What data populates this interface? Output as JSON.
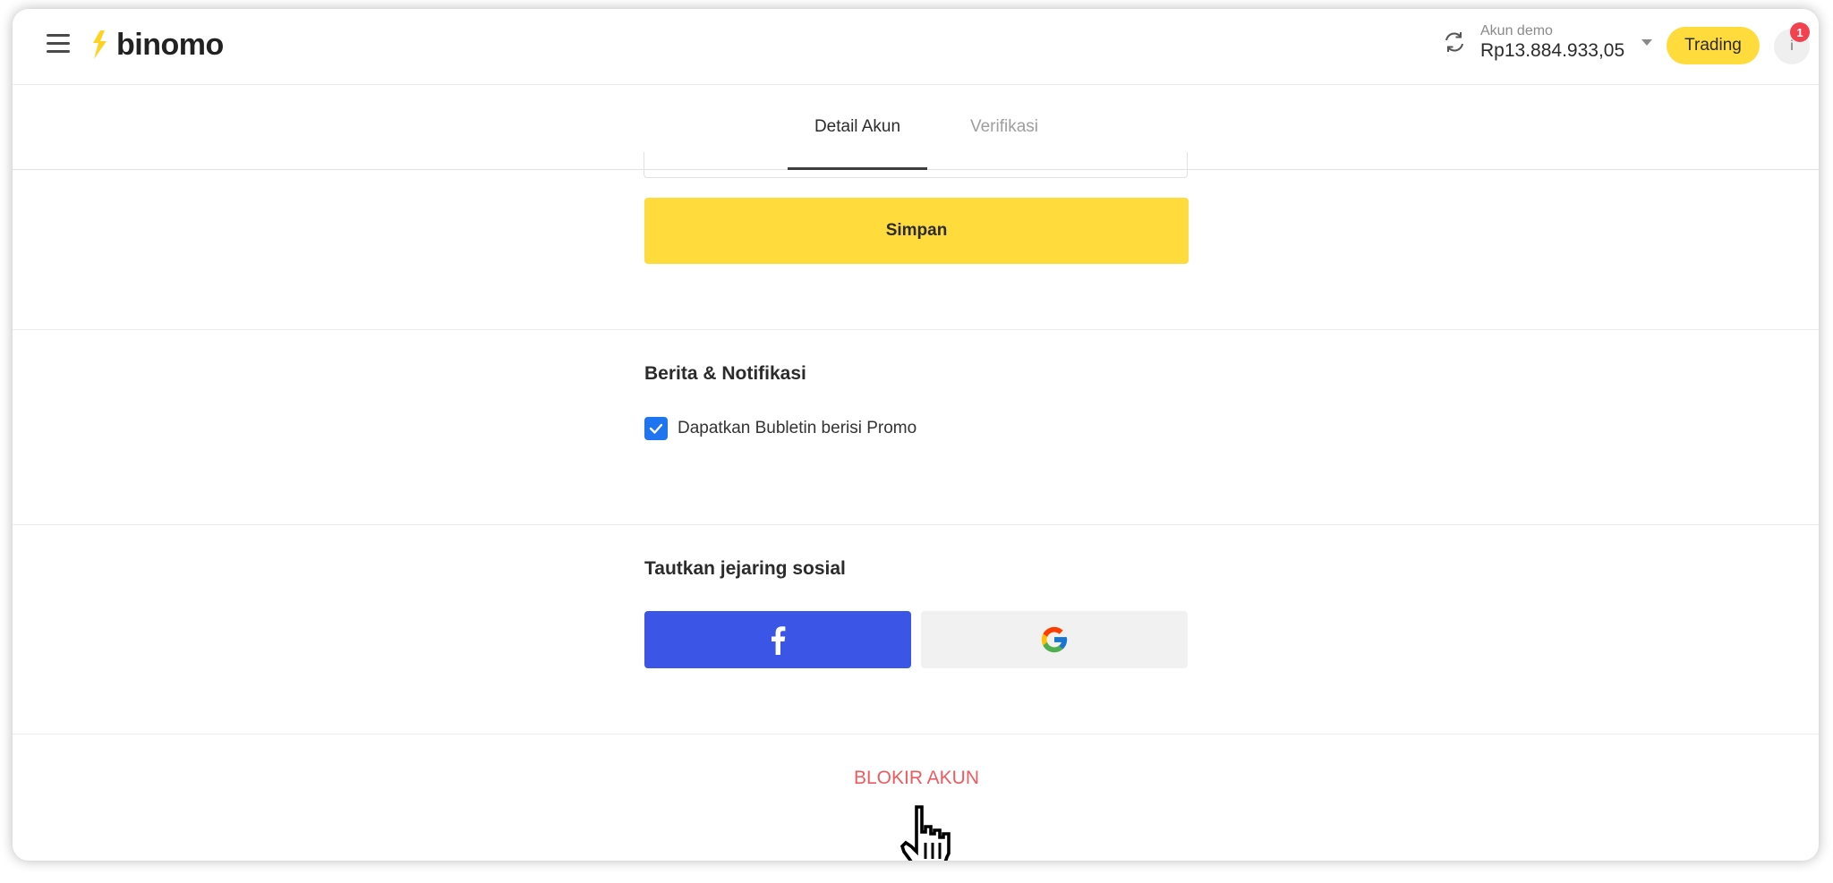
{
  "header": {
    "logo_text": "binomo",
    "account_label": "Akun demo",
    "balance": "Rp13.884.933,05",
    "trading_label": "Trading",
    "profile_initial": "i",
    "notification_count": "1"
  },
  "tabs": [
    {
      "label": "Detail Akun",
      "active": true
    },
    {
      "label": "Verifikasi",
      "active": false
    }
  ],
  "form": {
    "save_label": "Simpan"
  },
  "news": {
    "title": "Berita & Notifikasi",
    "checkbox_label": "Dapatkan Bubletin berisi Promo",
    "checked": true
  },
  "social": {
    "title": "Tautkan jejaring sosial",
    "providers": [
      "facebook-icon",
      "google-icon"
    ]
  },
  "block_account_label": "BLOKIR AKUN",
  "colors": {
    "accent_yellow": "#ffdc3c",
    "facebook_blue": "#3b55e6",
    "checkbox_blue": "#1f74ef",
    "danger_red": "#ee5a5f",
    "badge_red": "#f2424f"
  }
}
